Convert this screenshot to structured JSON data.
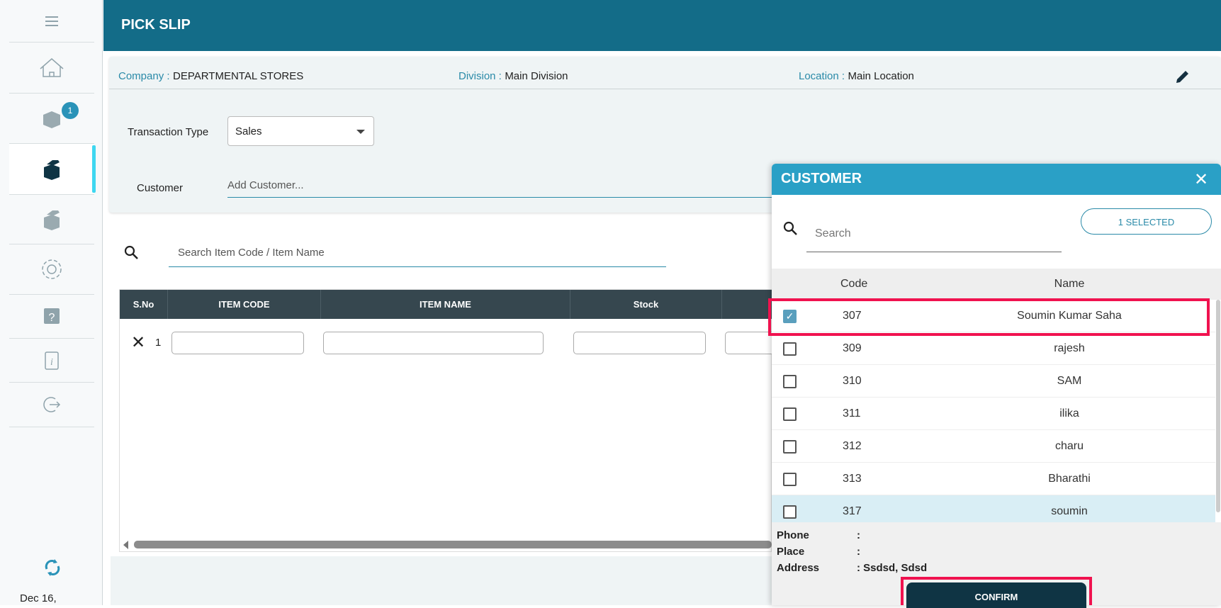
{
  "sidebar": {
    "badge_count": "1",
    "date": "Dec 16,",
    "items": [
      "menu",
      "home",
      "pending-picks",
      "pick-slip",
      "dispatch",
      "settings",
      "help",
      "info",
      "logout"
    ]
  },
  "header": {
    "title": "PICK SLIP"
  },
  "info": {
    "company_label": "Company :",
    "company": "DEPARTMENTAL STORES",
    "division_label": "Division :",
    "division": "Main Division",
    "location_label": "Location :",
    "location": "Main Location"
  },
  "form": {
    "transaction_type_label": "Transaction Type",
    "transaction_type": "Sales",
    "customer_label": "Customer",
    "customer_placeholder": "Add Customer..."
  },
  "item_search": {
    "placeholder": "Search Item Code / Item Name"
  },
  "table": {
    "columns": [
      "S.No",
      "ITEM CODE",
      "ITEM NAME",
      "Stock"
    ],
    "rows": [
      {
        "sno": "1"
      }
    ]
  },
  "modal": {
    "title": "CUSTOMER",
    "search_placeholder": "Search",
    "selected_label": "1 SELECTED",
    "col_code": "Code",
    "col_name": "Name",
    "rows": [
      {
        "code": "307",
        "name": "Soumin Kumar Saha",
        "checked": true
      },
      {
        "code": "309",
        "name": "rajesh"
      },
      {
        "code": "310",
        "name": "SAM"
      },
      {
        "code": "311",
        "name": "ilika"
      },
      {
        "code": "312",
        "name": "charu"
      },
      {
        "code": "313",
        "name": "Bharathi"
      },
      {
        "code": "317",
        "name": "soumin"
      }
    ],
    "phone_label": "Phone",
    "phone": ":",
    "place_label": "Place",
    "place": ":",
    "address_label": "Address",
    "address": ": Ssdsd, Sdsd",
    "confirm": "CONFIRM"
  },
  "colors": {
    "header": "#136c88",
    "modal_header": "#2aa0c6",
    "highlight": "#f0124f"
  }
}
